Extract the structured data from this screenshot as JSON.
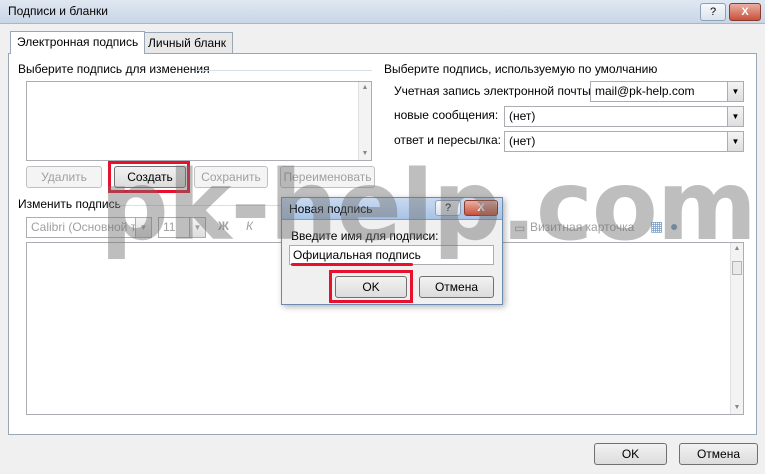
{
  "window": {
    "title": "Подписи и бланки",
    "help_label": "?",
    "close_label": "X"
  },
  "tabs": [
    {
      "label": "Электронная подпись",
      "active": true
    },
    {
      "label": "Личный бланк",
      "active": false
    }
  ],
  "left": {
    "select_label": "Выберите подпись для изменения",
    "buttons": {
      "delete": "Удалить",
      "create": "Создать",
      "save": "Сохранить",
      "rename": "Переименовать"
    }
  },
  "right": {
    "section_label": "Выберите подпись, используемую по умолчанию",
    "account_label": "Учетная запись электронной почты:",
    "account_value": "mail@pk-help.com",
    "new_label": "новые сообщения:",
    "new_value": "(нет)",
    "reply_label": "ответ и пересылка:",
    "reply_value": "(нет)"
  },
  "edit": {
    "section_label": "Изменить подпись",
    "font_value": "Calibri (Основной текст)",
    "size_value": "11",
    "bold": "Ж",
    "italic": "К",
    "business_card": "Визитная карточка"
  },
  "dialog": {
    "title": "Новая подпись",
    "help_label": "?",
    "close_label": "X",
    "prompt": "Введите имя для подписи:",
    "input_value": "Официальная подпись",
    "ok": "OK",
    "cancel": "Отмена"
  },
  "footer": {
    "ok": "OK",
    "cancel": "Отмена"
  },
  "watermark": "pk-help.com",
  "colors": {
    "highlight": "#e8112d",
    "titlebar": "#c9d6e6",
    "dialog_titlebar": "#a8c3e6"
  }
}
